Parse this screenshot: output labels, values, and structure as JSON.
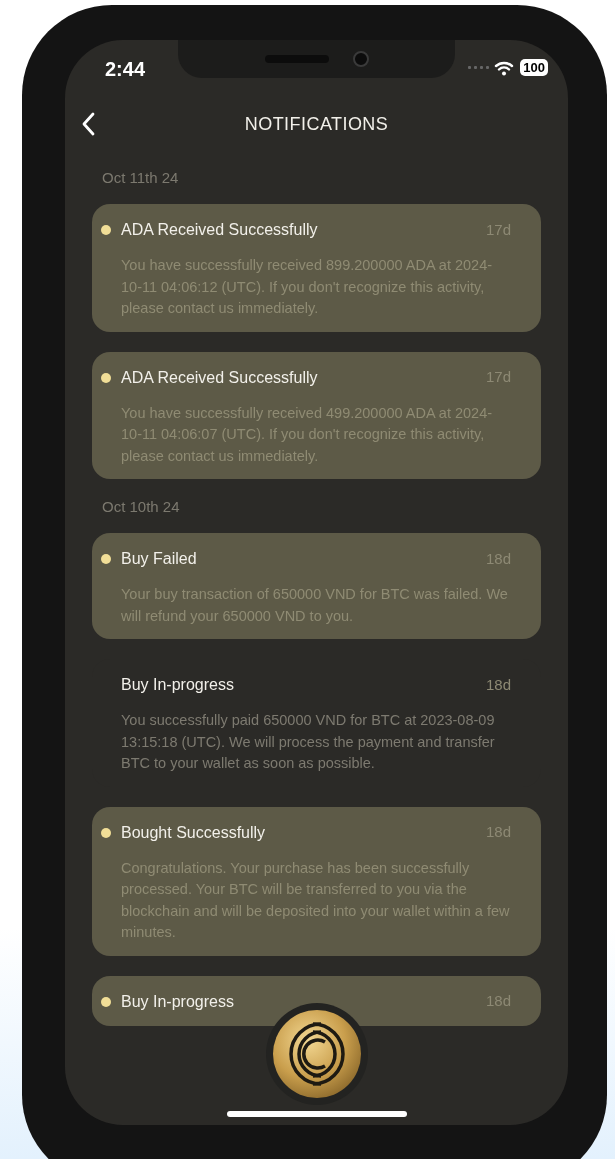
{
  "status_bar": {
    "time": "2:44",
    "battery": "100"
  },
  "header": {
    "title": "NOTIFICATIONS"
  },
  "sections": [
    {
      "date": "Oct 11th 24",
      "items": [
        {
          "title": "ADA Received Successfully",
          "age": "17d",
          "body": "You have successfully received 899.200000 ADA at 2024-10-11 04:06:12 (UTC). If you don't recognize this activity, please contact us immediately.",
          "unread": true
        },
        {
          "title": "ADA Received Successfully",
          "age": "17d",
          "body": "You have successfully received 499.200000 ADA at 2024-10-11 04:06:07 (UTC). If you don't recognize this activity, please contact us immediately.",
          "unread": true
        }
      ]
    },
    {
      "date": "Oct 10th 24",
      "items": [
        {
          "title": "Buy Failed",
          "age": "18d",
          "body": "Your buy transaction of 650000 VND for BTC was failed. We will refund your 650000 VND to you.",
          "unread": true
        },
        {
          "title": "Buy In-progress",
          "age": "18d",
          "body": "You successfully paid 650000 VND for BTC at 2023-08-09 13:15:18 (UTC). We will process the payment and transfer BTC to your wallet as soon as possible.",
          "unread": false
        },
        {
          "title": "Bought Successfully",
          "age": "18d",
          "body": "Congratulations. Your purchase has been successfully processed. Your BTC will be transferred to you via the blockchain and will be deposited into your wallet within a few minutes.",
          "unread": true
        },
        {
          "title": "Buy In-progress",
          "age": "18d",
          "unread": true
        }
      ]
    }
  ]
}
